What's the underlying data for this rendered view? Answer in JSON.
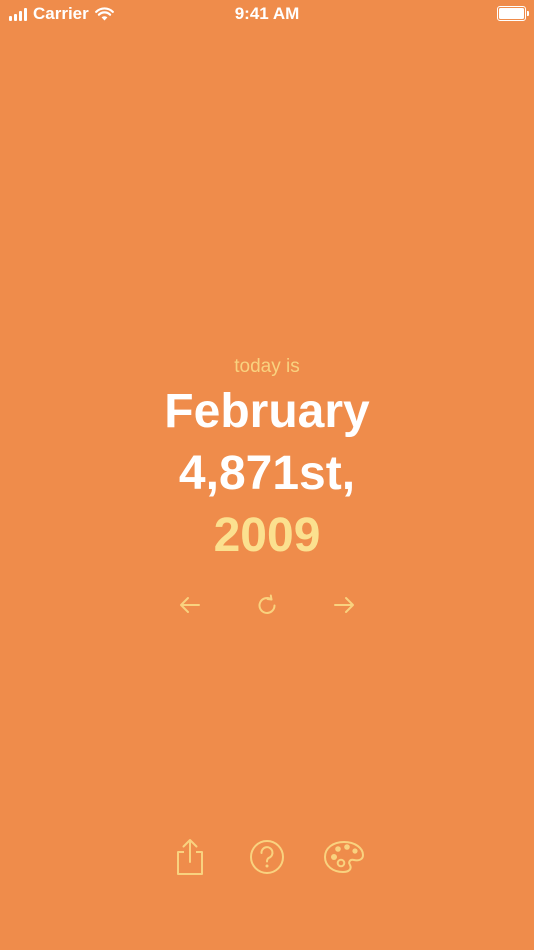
{
  "status_bar": {
    "carrier": "Carrier",
    "time": "9:41 AM",
    "icons": [
      "signal-icon",
      "wifi-icon",
      "battery-icon"
    ]
  },
  "date_display": {
    "label": "today is",
    "month_line": "February",
    "day_line": "4,871st,",
    "year_line": "2009"
  },
  "navigation": {
    "icons": [
      "arrow-left-icon",
      "refresh-icon",
      "arrow-right-icon"
    ]
  },
  "toolbar": {
    "icons": [
      "share-icon",
      "help-icon",
      "palette-icon"
    ]
  },
  "colors": {
    "background": "#ef8c4b",
    "accent": "#f9d27f",
    "primary_text": "#ffffff"
  }
}
